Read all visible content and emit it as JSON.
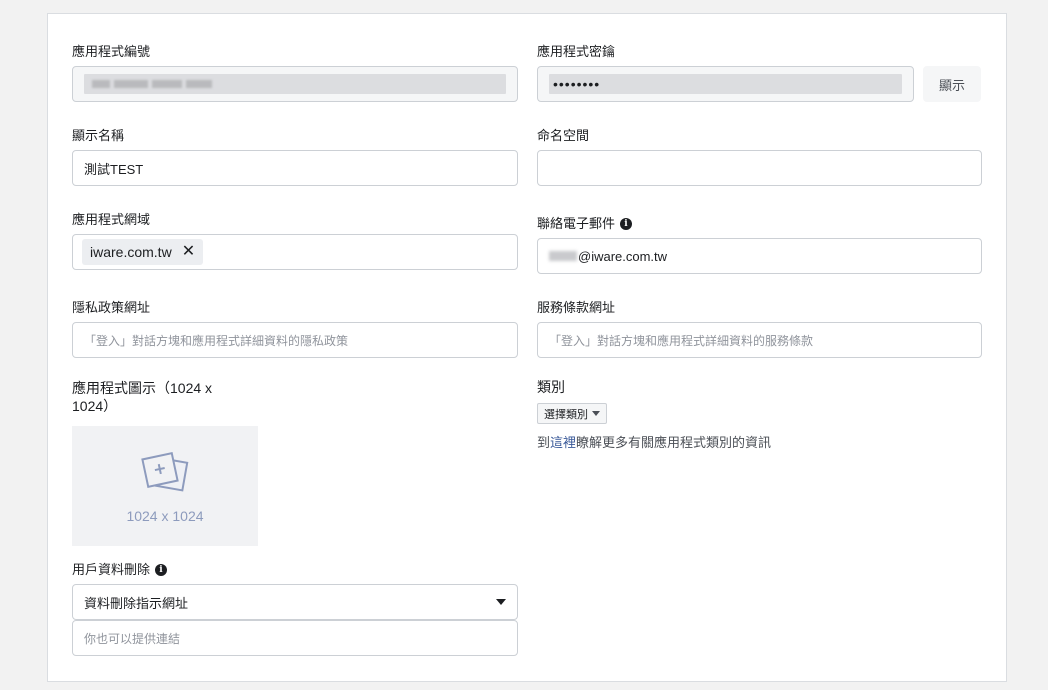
{
  "app_id": {
    "label": "應用程式編號"
  },
  "app_secret": {
    "label": "應用程式密鑰",
    "value": "••••••••",
    "show_button": "顯示"
  },
  "display_name": {
    "label": "顯示名稱",
    "value": "測試TEST"
  },
  "namespace": {
    "label": "命名空間",
    "value": ""
  },
  "app_domains": {
    "label": "應用程式網域",
    "tag": "iware.com.tw",
    "remove_glyph": "✕"
  },
  "contact_email": {
    "label": "聯絡電子郵件",
    "value": "@iware.com.tw"
  },
  "privacy_url": {
    "label": "隱私政策網址",
    "placeholder": "「登入」對話方塊和應用程式詳細資料的隱私政策"
  },
  "terms_url": {
    "label": "服務條款網址",
    "placeholder": "「登入」對話方塊和應用程式詳細資料的服務條款"
  },
  "app_icon": {
    "label": "應用程式圖示（1024 x 1024）",
    "dimensions": "1024 x 1024",
    "icon": "add-image-icon"
  },
  "category": {
    "label": "類別",
    "select_value": "選擇類別",
    "help_prefix": "到",
    "help_link": "這裡",
    "help_suffix": "瞭解更多有關應用程式類別的資訊"
  },
  "data_deletion": {
    "label": "用戶資料刪除",
    "dropdown_value": "資料刪除指示網址",
    "placeholder": "你也可以提供連結"
  },
  "colors": {
    "link": "#385898",
    "border": "#ccd0d5",
    "icon_tint": "#8d9bbd"
  }
}
